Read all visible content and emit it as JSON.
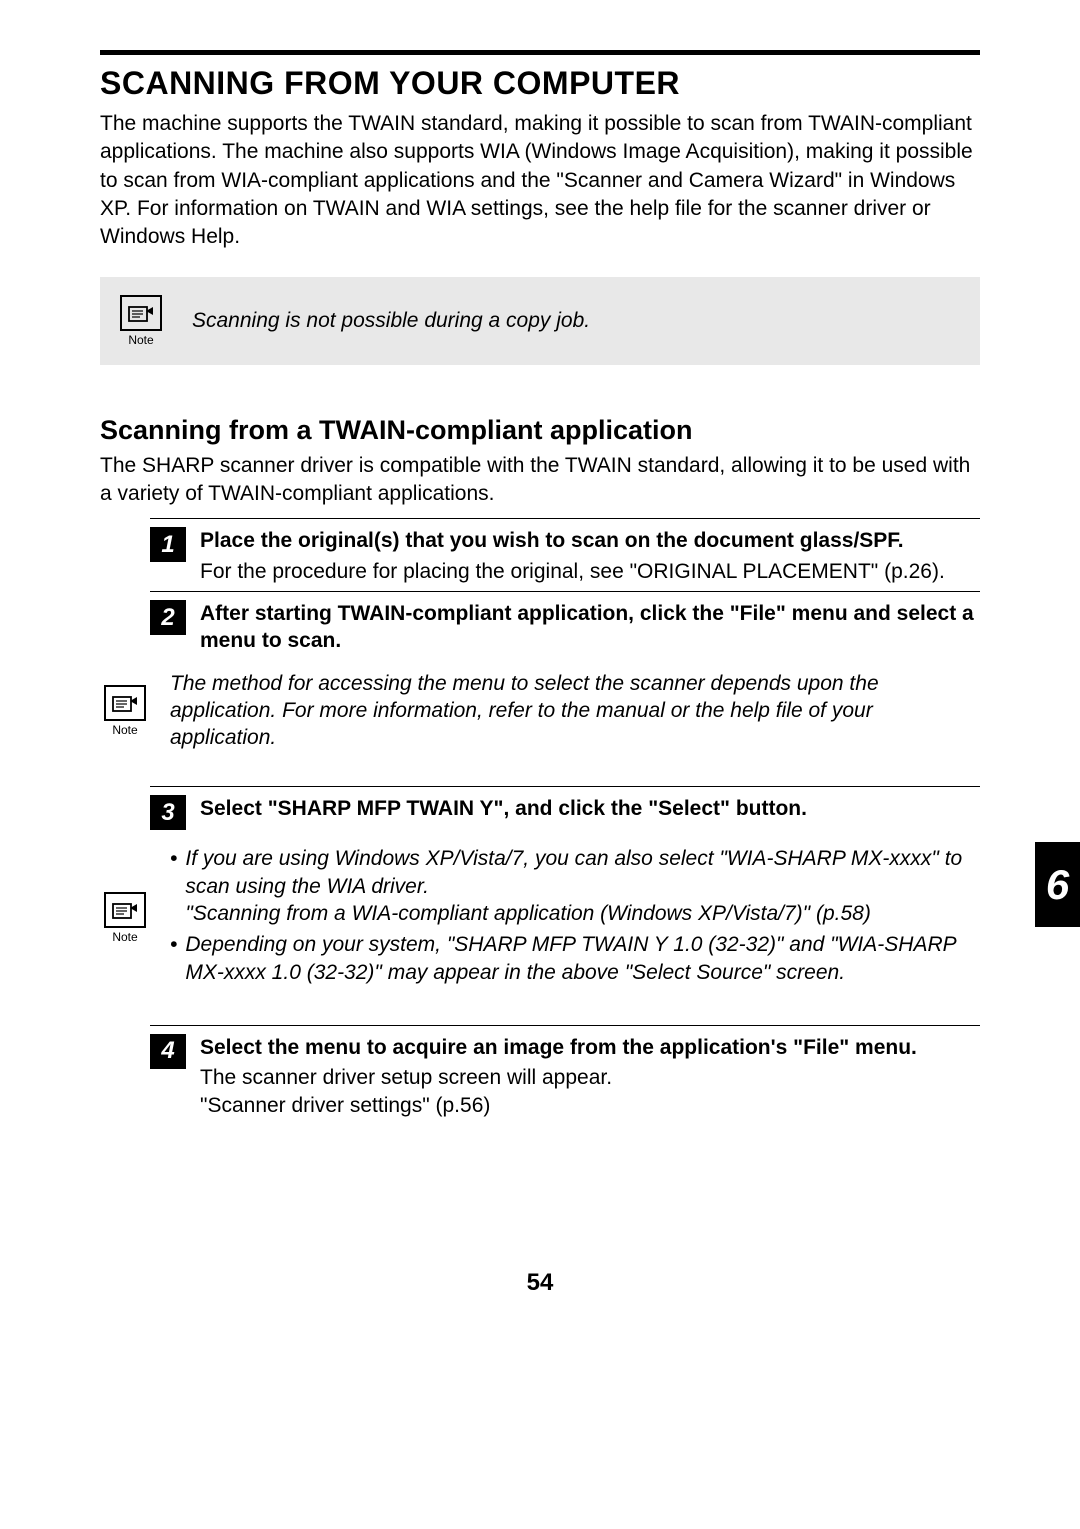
{
  "main_heading": "SCANNING FROM YOUR COMPUTER",
  "intro_text": "The machine supports the TWAIN standard, making it possible to scan from TWAIN-compliant applications. The machine also supports WIA (Windows Image Acquisition), making it possible to scan from WIA-compliant applications and the \"Scanner and Camera Wizard\" in Windows XP. For information on TWAIN and WIA settings, see the help file for the scanner driver or Windows Help.",
  "note1": {
    "label": "Note",
    "text": "Scanning is not possible during a copy job."
  },
  "sub_heading": "Scanning from a TWAIN-compliant application",
  "sub_intro": "The SHARP scanner driver is compatible with the TWAIN standard, allowing it to be used with a variety of TWAIN-compliant applications.",
  "steps": [
    {
      "num": "1",
      "title": "Place the original(s) that you wish to scan on the document glass/SPF.",
      "desc": "For the procedure for placing the original, see \"ORIGINAL PLACEMENT\" (p.26)."
    },
    {
      "num": "2",
      "title": "After starting TWAIN-compliant application, click the \"File\" menu and select a menu to scan.",
      "desc": ""
    },
    {
      "num": "3",
      "title": "Select \"SHARP MFP TWAIN Y\", and click the \"Select\" button.",
      "desc": ""
    },
    {
      "num": "4",
      "title": "Select the menu to acquire an image from the application's \"File\" menu.",
      "desc_line1": "The scanner driver setup screen will appear.",
      "desc_line2": "\"Scanner driver settings\" (p.56)"
    }
  ],
  "note2": {
    "label": "Note",
    "text": "The method for accessing the menu to select the scanner depends upon the application. For more information, refer to the manual or the help file of your application."
  },
  "note3": {
    "label": "Note",
    "bullets": [
      "If you are using Windows XP/Vista/7, you can also select \"WIA-SHARP MX-xxxx\" to scan using the WIA driver.\n\"Scanning from a WIA-compliant application (Windows XP/Vista/7)\" (p.58)",
      "Depending on your system, \"SHARP MFP TWAIN Y 1.0 (32-32)\" and \"WIA-SHARP MX-xxxx 1.0 (32-32)\" may appear in the above \"Select Source\" screen."
    ]
  },
  "side_tab": "6",
  "page_number": "54"
}
